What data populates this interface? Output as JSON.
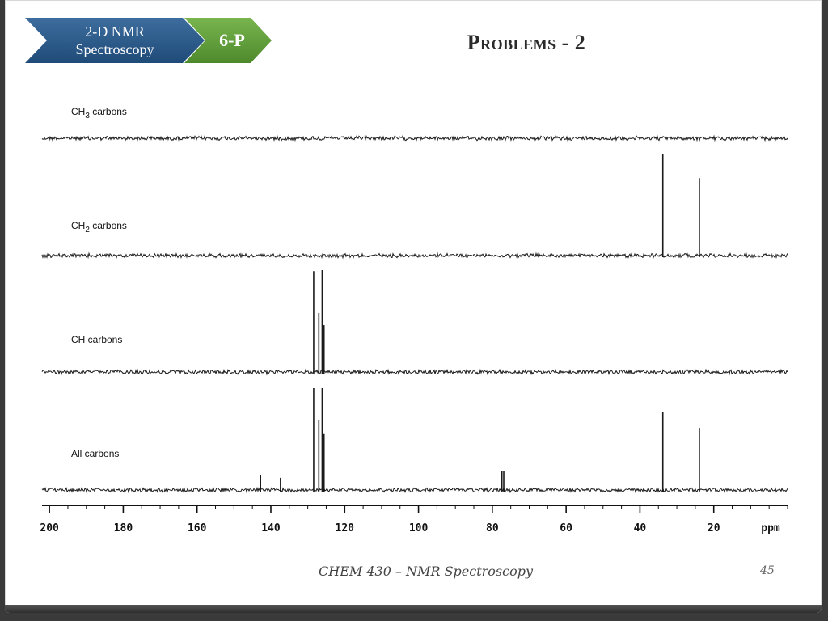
{
  "header": {
    "topic_line1": "2-D NMR",
    "topic_line2": "Spectroscopy",
    "section_code": "6-P",
    "title": "Problems - 2"
  },
  "footer": {
    "course": "CHEM 430 – NMR Spectroscopy",
    "page_number": "45"
  },
  "colors": {
    "topic_chevron": "#2a5a8a",
    "code_chevron": "#5e9b3a",
    "trace": "#1a1a1a"
  },
  "chart_data": {
    "type": "line",
    "title": "",
    "xlabel": "ppm",
    "ylabel": "",
    "xlim": [
      202,
      0
    ],
    "x_reversed": true,
    "x_ticks": [
      200,
      180,
      160,
      140,
      120,
      100,
      80,
      60,
      40,
      20
    ],
    "x_tick_labels": [
      "200",
      "180",
      "160",
      "140",
      "120",
      "100",
      "80",
      "60",
      "40",
      "20"
    ],
    "minor_tick_step": 5,
    "series": [
      {
        "name": "CH3 carbons",
        "label_main": "CH",
        "label_sub": "3",
        "label_rest": " carbons",
        "peaks": []
      },
      {
        "name": "CH2 carbons",
        "label_main": "CH",
        "label_sub": "2",
        "label_rest": " carbons",
        "peaks": [
          {
            "ppm": 33.8,
            "height": 1.0
          },
          {
            "ppm": 23.9,
            "height": 0.76
          }
        ]
      },
      {
        "name": "CH carbons",
        "label_main": "CH carbons",
        "label_sub": "",
        "label_rest": "",
        "peaks": [
          {
            "ppm": 128.4,
            "height": 0.99
          },
          {
            "ppm": 127.0,
            "height": 0.58
          },
          {
            "ppm": 126.1,
            "height": 1.0
          },
          {
            "ppm": 125.6,
            "height": 0.46
          }
        ]
      },
      {
        "name": "All carbons",
        "label_main": "All carbons",
        "label_sub": "",
        "label_rest": "",
        "peaks": [
          {
            "ppm": 142.8,
            "height": 0.15
          },
          {
            "ppm": 137.4,
            "height": 0.12
          },
          {
            "ppm": 128.4,
            "height": 1.0
          },
          {
            "ppm": 127.0,
            "height": 0.69
          },
          {
            "ppm": 126.1,
            "height": 1.0
          },
          {
            "ppm": 125.6,
            "height": 0.55
          },
          {
            "ppm": 77.4,
            "height": 0.19
          },
          {
            "ppm": 76.9,
            "height": 0.19
          },
          {
            "ppm": 33.8,
            "height": 0.77
          },
          {
            "ppm": 23.9,
            "height": 0.61
          }
        ]
      }
    ]
  }
}
